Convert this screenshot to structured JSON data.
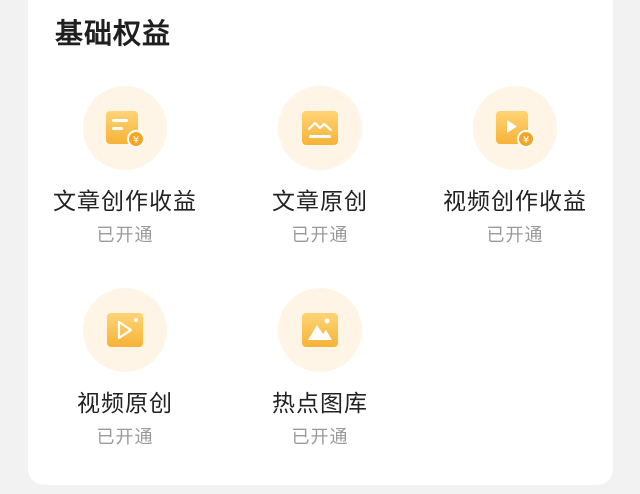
{
  "section": {
    "title": "基础权益"
  },
  "colors": {
    "icon_bg": "#fff5e6",
    "icon_gold": "#f6b93b",
    "icon_gold_light": "#ffd476",
    "status_gray": "#9a9a9a"
  },
  "benefits": [
    {
      "name": "文章创作收益",
      "status": "已开通",
      "icon": "article-income-icon"
    },
    {
      "name": "文章原创",
      "status": "已开通",
      "icon": "article-original-icon"
    },
    {
      "name": "视频创作收益",
      "status": "已开通",
      "icon": "video-income-icon"
    },
    {
      "name": "视频原创",
      "status": "已开通",
      "icon": "video-original-icon"
    },
    {
      "name": "热点图库",
      "status": "已开通",
      "icon": "hot-gallery-icon"
    }
  ]
}
